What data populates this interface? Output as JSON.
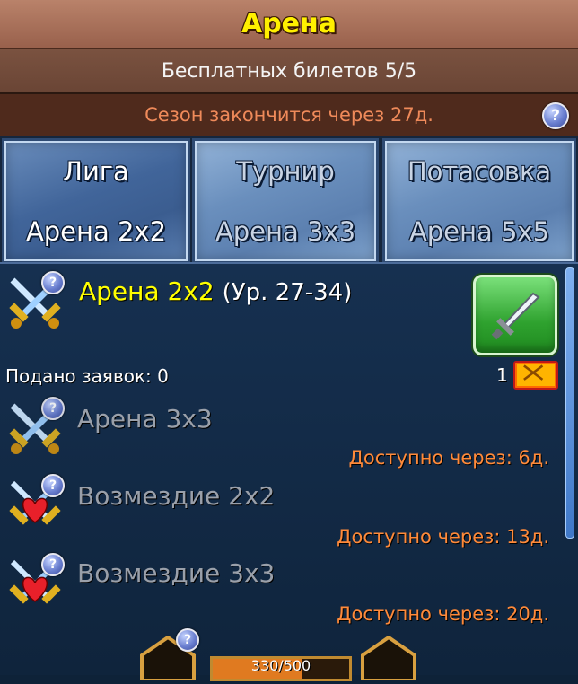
{
  "window": {
    "title": "Арена"
  },
  "info": {
    "tickets": "Бесплатных билетов 5/5",
    "season": "Сезон закончится через 27д.",
    "help_glyph": "?"
  },
  "tabs": [
    {
      "label": "Лига",
      "sub": "Арена 2x2",
      "active": true
    },
    {
      "label": "Турнир",
      "sub": "Арена 3x3",
      "active": false
    },
    {
      "label": "Потасовка",
      "sub": "Арена 5x5",
      "active": false
    }
  ],
  "current": {
    "name": "Арена 2x2",
    "level": "(Ур. 27-34)",
    "submitted": "Подано заявок: 0",
    "ticket_count": "1",
    "fight_icon": "sword-icon"
  },
  "upcoming": [
    {
      "name": "Арена 3x3",
      "available": "Доступно через: 6д.",
      "icon": "crossed-swords-icon"
    },
    {
      "name": "Возмездие 2x2",
      "available": "Доступно через: 13д.",
      "icon": "heart-swords-icon"
    },
    {
      "name": "Возмездие 3x3",
      "available": "Доступно через: 20д.",
      "icon": "heart-swords-icon"
    }
  ],
  "bottom": {
    "progress_text": "330/500",
    "progress_value": 0.66
  },
  "colors": {
    "title": "#fff000",
    "active_name": "#ffff00",
    "available": "#ff8a3a",
    "season": "#ef8a5a"
  }
}
